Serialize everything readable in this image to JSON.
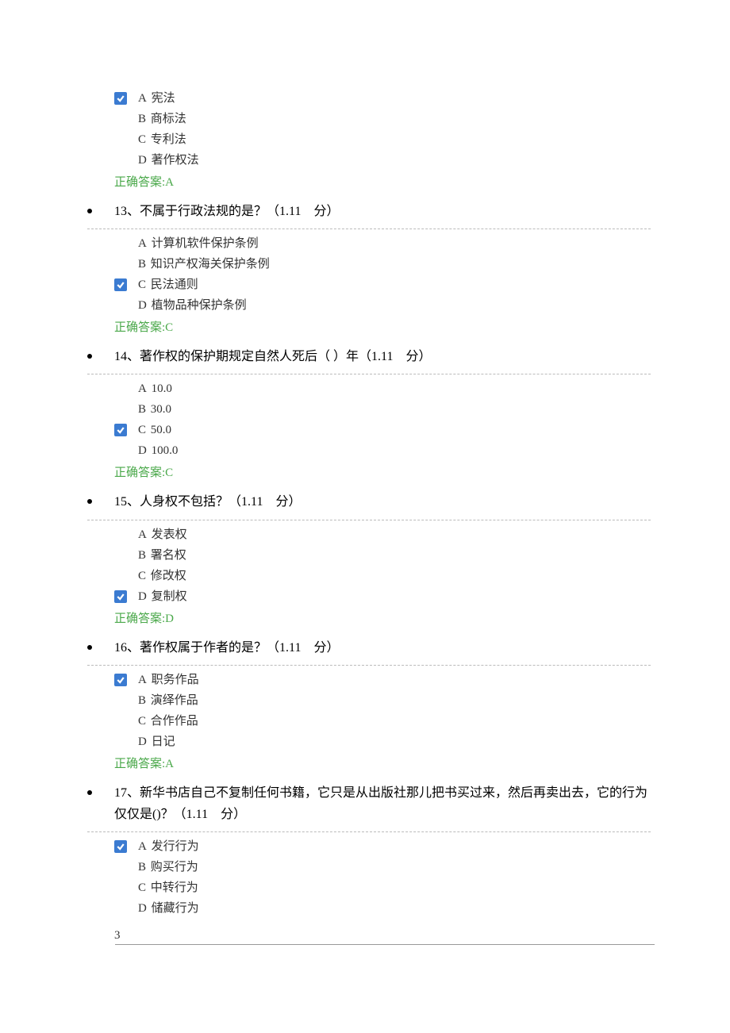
{
  "top_options": {
    "options": [
      {
        "letter": "A",
        "text": "宪法",
        "checked": true
      },
      {
        "letter": "B",
        "text": "商标法",
        "checked": false
      },
      {
        "letter": "C",
        "text": "专利法",
        "checked": false
      },
      {
        "letter": "D",
        "text": "著作权法",
        "checked": false
      }
    ],
    "correct_label": "正确答案:A"
  },
  "questions": [
    {
      "number": "13",
      "text": "不属于行政法规的是？",
      "points": "（1.11　分）",
      "options": [
        {
          "letter": "A",
          "text": "计算机软件保护条例",
          "checked": false
        },
        {
          "letter": "B",
          "text": "知识产权海关保护条例",
          "checked": false
        },
        {
          "letter": "C",
          "text": "民法通则",
          "checked": true
        },
        {
          "letter": "D",
          "text": "植物品种保护条例",
          "checked": false
        }
      ],
      "correct_label": "正确答案:C"
    },
    {
      "number": "14",
      "text": "著作权的保护期规定自然人死后（  ）年",
      "points": "（1.11　分）",
      "options": [
        {
          "letter": "A",
          "text": "10.0",
          "checked": false
        },
        {
          "letter": "B",
          "text": "30.0",
          "checked": false
        },
        {
          "letter": "C",
          "text": "50.0",
          "checked": true
        },
        {
          "letter": "D",
          "text": "100.0",
          "checked": false
        }
      ],
      "correct_label": "正确答案:C"
    },
    {
      "number": "15",
      "text": "人身权不包括？",
      "points": "（1.11　分）",
      "options": [
        {
          "letter": "A",
          "text": "发表权",
          "checked": false
        },
        {
          "letter": "B",
          "text": "署名权",
          "checked": false
        },
        {
          "letter": "C",
          "text": "修改权",
          "checked": false
        },
        {
          "letter": "D",
          "text": "复制权",
          "checked": true
        }
      ],
      "correct_label": "正确答案:D"
    },
    {
      "number": "16",
      "text": "著作权属于作者的是？",
      "points": "（1.11　分）",
      "options": [
        {
          "letter": "A",
          "text": "职务作品",
          "checked": true
        },
        {
          "letter": "B",
          "text": "演绎作品",
          "checked": false
        },
        {
          "letter": "C",
          "text": "合作作品",
          "checked": false
        },
        {
          "letter": "D",
          "text": "日记",
          "checked": false
        }
      ],
      "correct_label": "正确答案:A"
    },
    {
      "number": "17",
      "text": "新华书店自己不复制任何书籍，它只是从出版社那儿把书买过来，然后再卖出去，它的行为仅仅是()？",
      "points": "（1.11　分）",
      "options": [
        {
          "letter": "A",
          "text": "发行行为",
          "checked": true
        },
        {
          "letter": "B",
          "text": "购买行为",
          "checked": false
        },
        {
          "letter": "C",
          "text": "中转行为",
          "checked": false
        },
        {
          "letter": "D",
          "text": "储藏行为",
          "checked": false
        }
      ],
      "correct_label": ""
    }
  ],
  "page_number": "3",
  "separator": "、"
}
